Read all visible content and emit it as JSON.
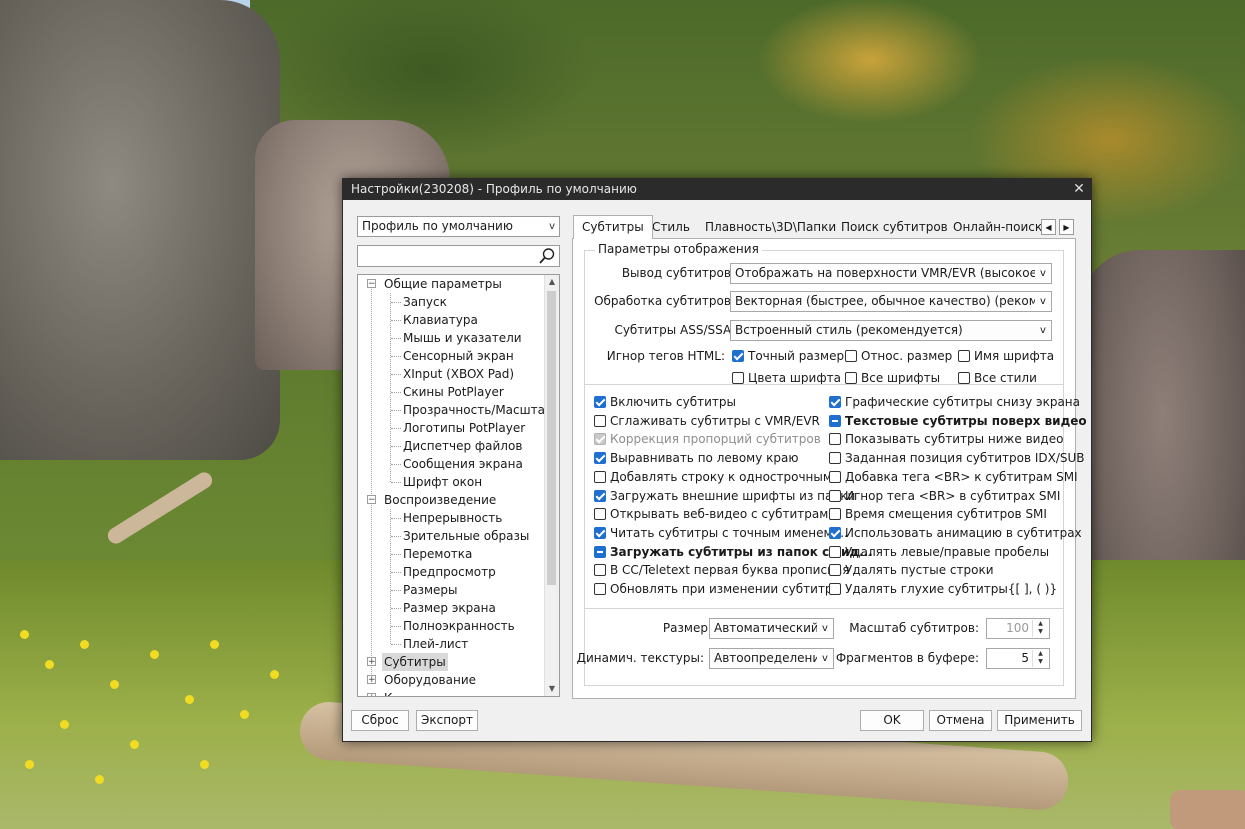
{
  "window": {
    "title": "Настройки(230208) - Профиль по умолчанию",
    "close_glyph": "✕"
  },
  "profile": {
    "selected": "Профиль по умолчанию"
  },
  "search": {
    "placeholder": ""
  },
  "tree": {
    "general": "Общие параметры",
    "general_items": [
      "Запуск",
      "Клавиатура",
      "Мышь и указатели",
      "Сенсорный экран",
      "XInput (XBOX Pad)",
      "Скины PotPlayer",
      "Прозрачность/Масштаб",
      "Логотипы PotPlayer",
      "Диспетчер файлов",
      "Сообщения экрана",
      "Шрифт окон"
    ],
    "playback": "Воспроизведение",
    "playback_items": [
      "Непрерывность",
      "Зрительные образы",
      "Перемотка",
      "Предпросмотр",
      "Размеры",
      "Размер экрана",
      "Полноэкранность",
      "Плей-лист"
    ],
    "subtitles": "Субтитры",
    "hardware": "Оборудование",
    "cutoff": "К"
  },
  "tabs": [
    "Субтитры",
    "Стиль",
    "Плавность\\3D\\Папки",
    "Поиск субтитров",
    "Онлайн-поиск с"
  ],
  "display": {
    "group_title": "Параметры отображения",
    "output_label": "Вывод субтитров:",
    "output_value": "Отображать на поверхности VMR/EVR (высокое качество)",
    "processing_label": "Обработка субтитров:",
    "processing_value": "Векторная (быстрее, обычное качество) (рекомендуется)",
    "ass_label": "Субтитры ASS/SSA:",
    "ass_value": "Встроенный стиль (рекомендуется)",
    "ignore_label": "Игнор тегов HTML:",
    "ignore_opts": [
      {
        "label": "Точный размер",
        "state": "on"
      },
      {
        "label": "Относ. размер",
        "state": "off"
      },
      {
        "label": "Имя шрифта",
        "state": "off"
      },
      {
        "label": "Цвета шрифта",
        "state": "off"
      },
      {
        "label": "Все шрифты",
        "state": "off"
      },
      {
        "label": "Все стили",
        "state": "off"
      }
    ]
  },
  "options_left": [
    {
      "label": "Включить субтитры",
      "state": "on"
    },
    {
      "label": "Сглаживать субтитры с VMR/EVR",
      "state": "off"
    },
    {
      "label": "Коррекция пропорций субтитров",
      "state": "dim"
    },
    {
      "label": "Выравнивать по левому краю",
      "state": "on"
    },
    {
      "label": "Добавлять строку к однострочным",
      "state": "off"
    },
    {
      "label": "Загружать внешние шрифты из папки",
      "state": "on"
    },
    {
      "label": "Открывать веб-видео с субтитрами",
      "state": "off"
    },
    {
      "label": "Читать субтитры с точным именем ...",
      "state": "on"
    },
    {
      "label": "Загружать субтитры из папок с вид...",
      "state": "mixed"
    },
    {
      "label": "В CC/Teletext первая буква прописная",
      "state": "off"
    },
    {
      "label": "Обновлять при изменении субтитра",
      "state": "off"
    }
  ],
  "options_right": [
    {
      "label": "Графические субтитры снизу экрана",
      "state": "on"
    },
    {
      "label": "Текстовые субтитры поверх видео",
      "state": "mixed"
    },
    {
      "label": "Показывать субтитры ниже видео",
      "state": "off"
    },
    {
      "label": "Заданная позиция субтитров IDX/SUB",
      "state": "off"
    },
    {
      "label": "Добавка тега <BR> к субтитрам SMI",
      "state": "off"
    },
    {
      "label": "Игнор тега <BR> в субтитрах SMI",
      "state": "off"
    },
    {
      "label": "Время смещения субтитров SMI",
      "state": "off"
    },
    {
      "label": "Использовать анимацию в субтитрах",
      "state": "on"
    },
    {
      "label": "Удалять левые/правые пробелы",
      "state": "off"
    },
    {
      "label": "Удалять пустые строки",
      "state": "off"
    },
    {
      "label": "Удалять глухие субтитры{[ ], ( )}",
      "state": "off"
    }
  ],
  "bottom": {
    "size_label": "Размер:",
    "size_value": "Автоматический",
    "textures_label": "Динамич. текстуры:",
    "textures_value": "Автоопределение",
    "scale_label": "Масштаб субтитров:",
    "scale_value": "100",
    "fragments_label": "Фрагментов в буфере:",
    "fragments_value": "5"
  },
  "buttons": {
    "reset": "Сброс",
    "export": "Экспорт",
    "ok": "OK",
    "cancel": "Отмена",
    "apply": "Применить"
  }
}
